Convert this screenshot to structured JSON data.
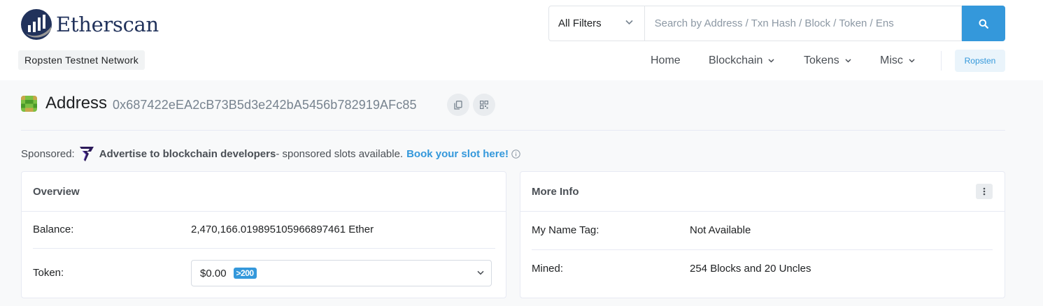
{
  "header": {
    "logo_text": "Etherscan",
    "network_label": "Ropsten Testnet Network",
    "search": {
      "filter_label": "All Filters",
      "placeholder": "Search by Address / Txn Hash / Block / Token / Ens"
    },
    "nav": {
      "home": "Home",
      "blockchain": "Blockchain",
      "tokens": "Tokens",
      "misc": "Misc",
      "network_button": "Ropsten"
    }
  },
  "title": {
    "label": "Address",
    "address": "0x687422eEA2cB73B5d3e242bA5456b782919AFc85"
  },
  "sponsored": {
    "prefix": "Sponsored:",
    "headline": "Advertise to blockchain developers",
    "text": " - sponsored slots available.",
    "link": "Book your slot here!"
  },
  "overview": {
    "title": "Overview",
    "balance_label": "Balance:",
    "balance_value": "2,470,166.019895105966897461 Ether",
    "token_label": "Token:",
    "token_value": "$0.00",
    "token_badge": ">200"
  },
  "more_info": {
    "title": "More Info",
    "name_tag_label": "My Name Tag:",
    "name_tag_value": "Not Available",
    "mined_label": "Mined:",
    "mined_value": "254 Blocks and 20 Uncles"
  },
  "colors": {
    "accent": "#3498db",
    "brand_dark": "#21325b",
    "border": "#e7eaf3",
    "page_bg": "#f8f9fa"
  },
  "icons": [
    "etherscan-logo-icon",
    "chevron-down-icon",
    "search-icon",
    "identicon-icon",
    "copy-icon",
    "qr-code-icon",
    "sponsor-logo-icon",
    "info-icon",
    "more-vertical-icon"
  ]
}
